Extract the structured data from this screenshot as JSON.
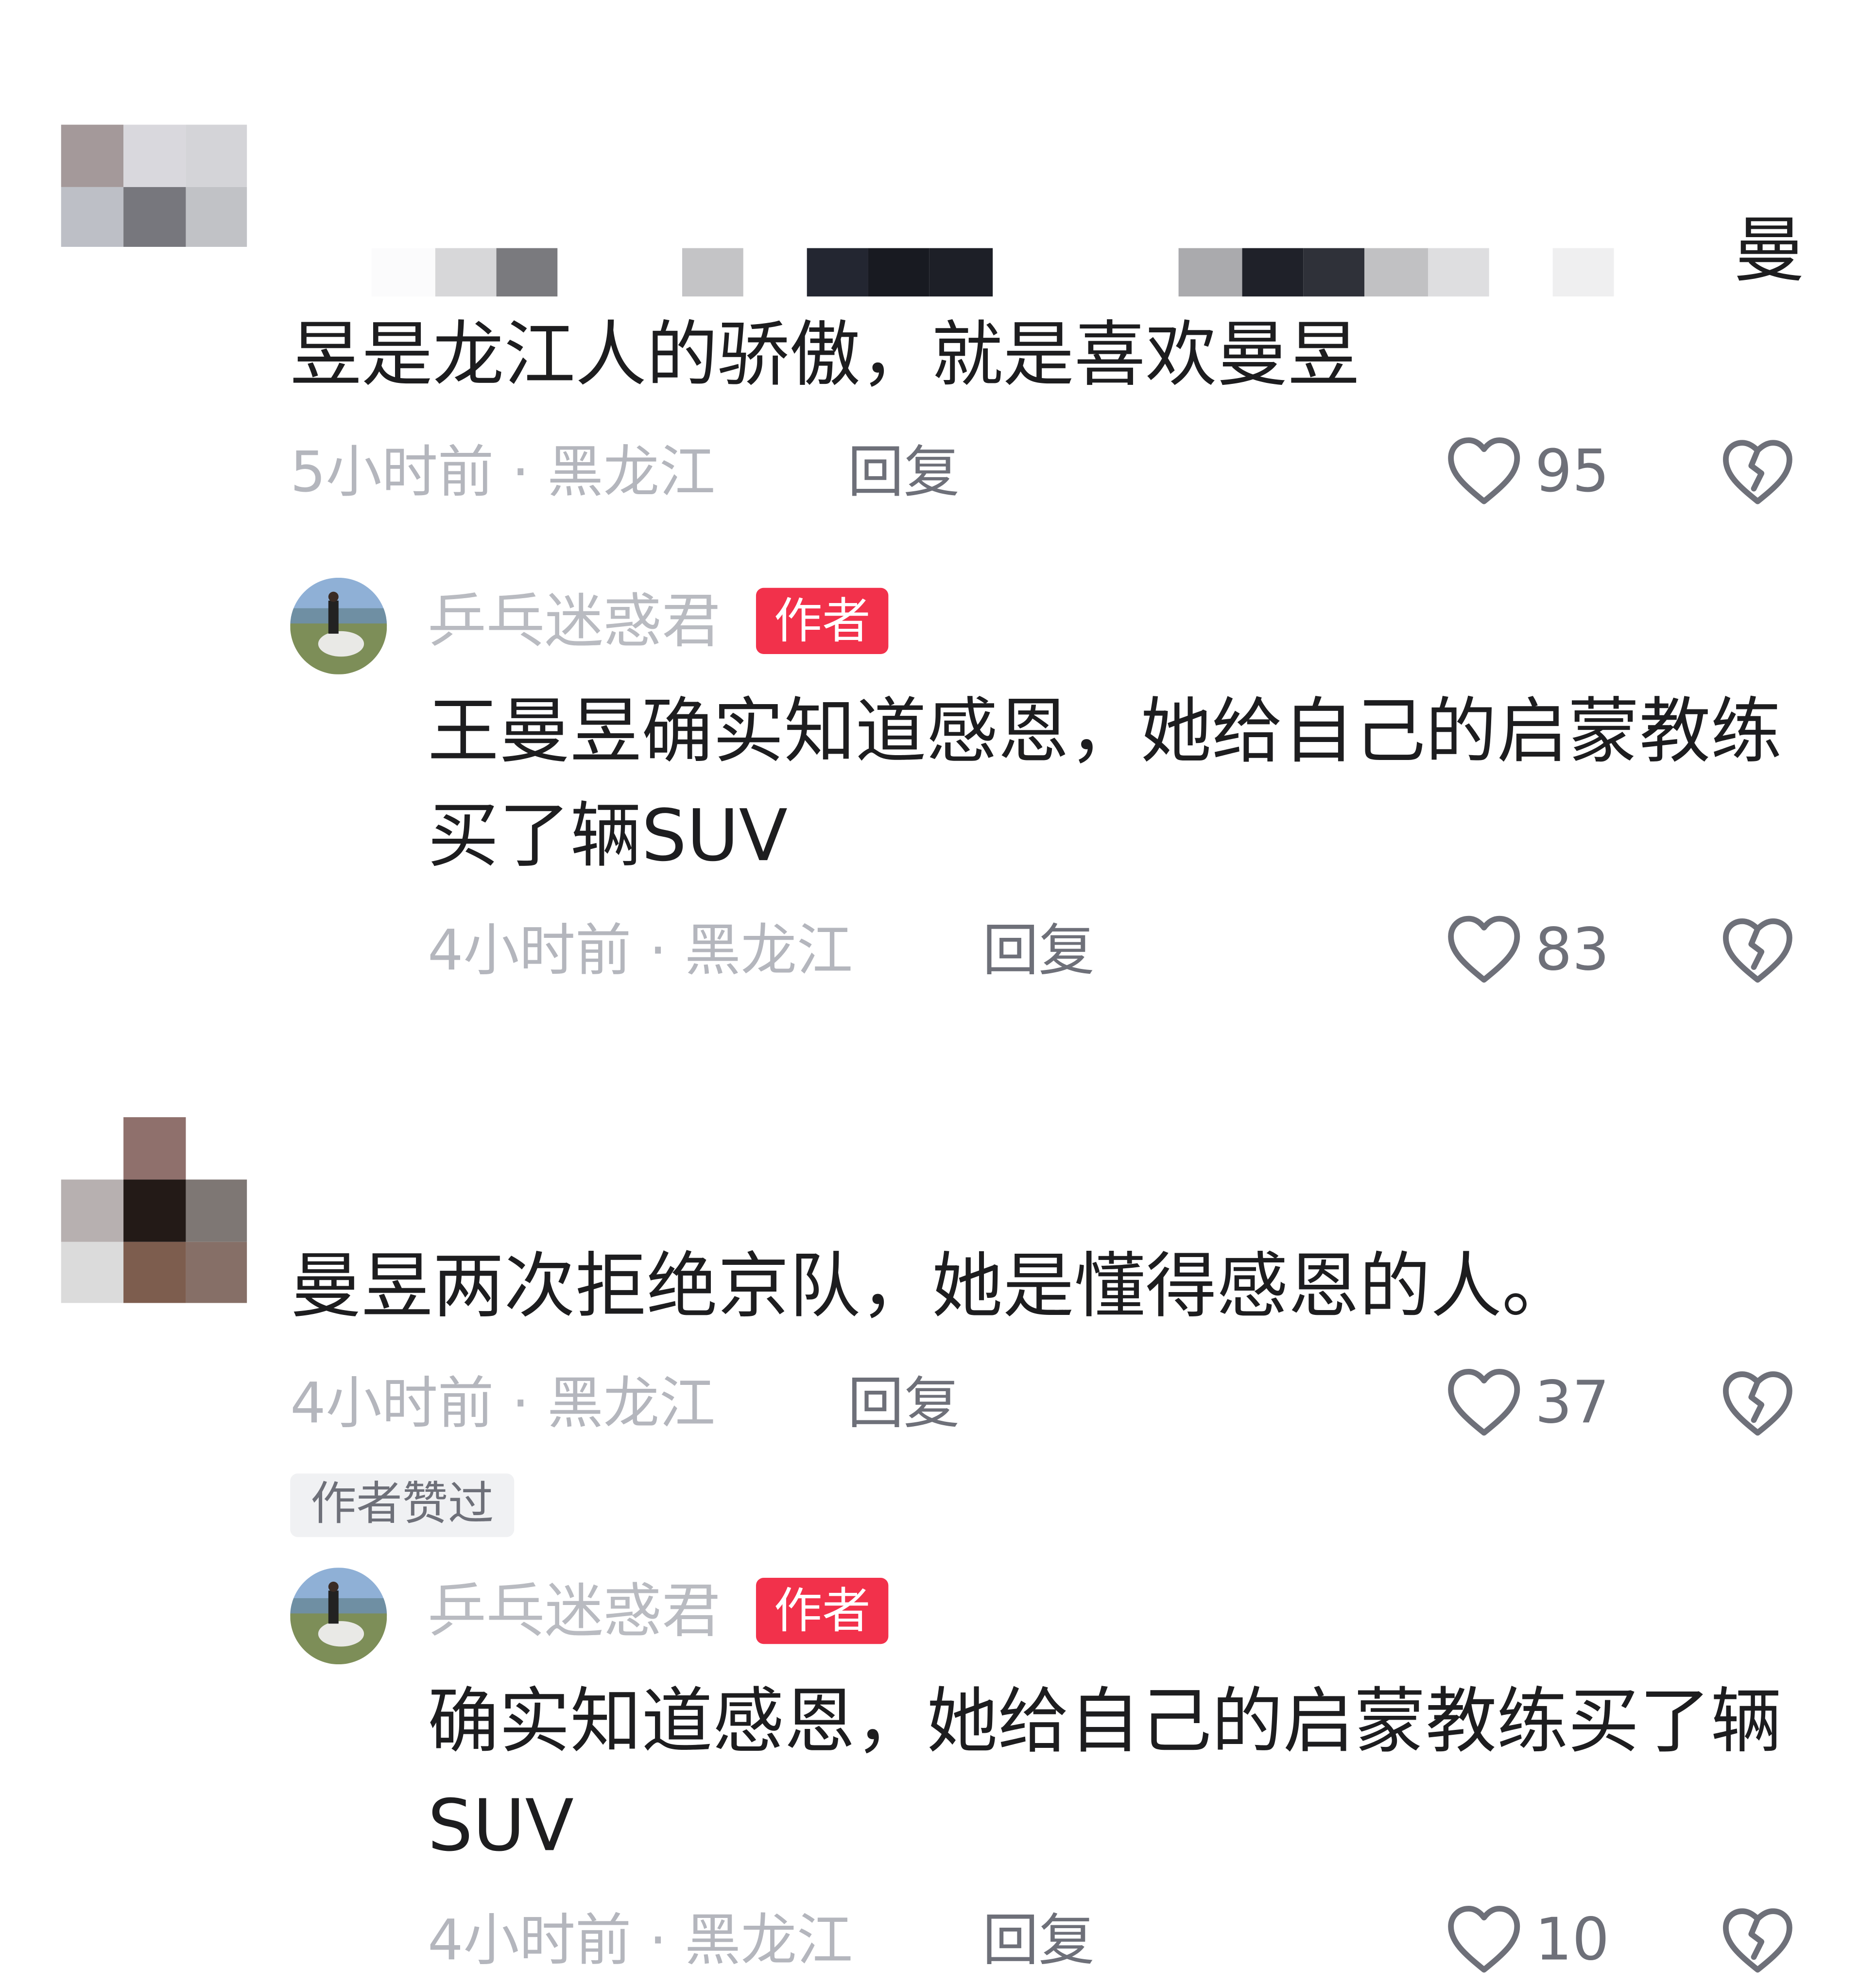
{
  "comments": [
    {
      "text_lead_char": "曼",
      "text_line": "昱是龙江人的骄傲，就是喜欢曼昱",
      "time": "5小时前",
      "location": "黑龙江",
      "reply_label": "回复",
      "likes": "95",
      "reply": {
        "author": "乒乓迷惑君",
        "badge": "作者",
        "text_lines": [
          "王曼昱确实知道感恩，她给自己的启蒙教练",
          "买了辆SUV"
        ],
        "time": "4小时前",
        "location": "黑龙江",
        "reply_label": "回复",
        "likes": "83"
      }
    },
    {
      "text_line": "曼昱两次拒绝京队，她是懂得感恩的人。",
      "time": "4小时前",
      "location": "黑龙江",
      "reply_label": "回复",
      "likes": "37",
      "author_liked_label": "作者赞过",
      "reply": {
        "author": "乒乓迷惑君",
        "badge": "作者",
        "text_lines": [
          "确实知道感恩，她给自己的启蒙教练买了辆",
          "SUV"
        ],
        "time": "4小时前",
        "location": "黑龙江",
        "reply_label": "回复",
        "likes": "10"
      }
    }
  ],
  "separator_dot": "·",
  "colors": {
    "text_primary": "#1d1d1f",
    "text_meta": "#b4b6bd",
    "text_secondary": "#6e7079",
    "author_badge": "#f2314b"
  },
  "icons": {
    "like": "heart-outline-icon",
    "dislike": "broken-heart-icon"
  }
}
